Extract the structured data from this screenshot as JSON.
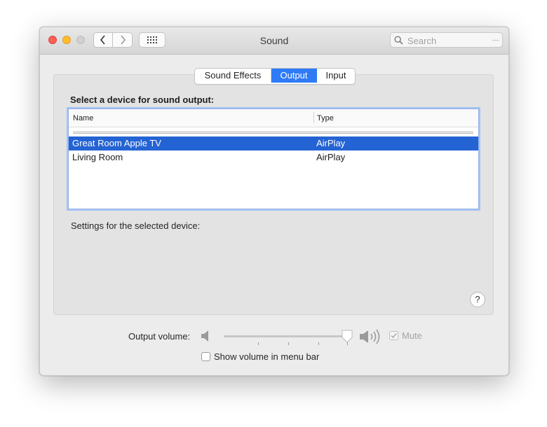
{
  "window": {
    "title": "Sound"
  },
  "toolbar": {
    "search_placeholder": "Search"
  },
  "tabs": [
    {
      "label": "Sound Effects",
      "active": false
    },
    {
      "label": "Output",
      "active": true
    },
    {
      "label": "Input",
      "active": false
    }
  ],
  "output": {
    "section_title": "Select a device for sound output:",
    "columns": {
      "name": "Name",
      "type": "Type"
    },
    "devices": [
      {
        "name": "Great Room Apple TV",
        "type": "AirPlay",
        "selected": true
      },
      {
        "name": "Living Room",
        "type": "AirPlay",
        "selected": false
      }
    ],
    "settings_label": "Settings for the selected device:"
  },
  "help": {
    "label": "?"
  },
  "volume": {
    "label": "Output volume:",
    "level": 0.98,
    "mute_label": "Mute",
    "mute_checked": true,
    "mute_enabled": false
  },
  "menu_bar": {
    "label": "Show volume in menu bar",
    "checked": false
  },
  "colors": {
    "accent": "#2f7bf6",
    "selection": "#2463d3"
  }
}
